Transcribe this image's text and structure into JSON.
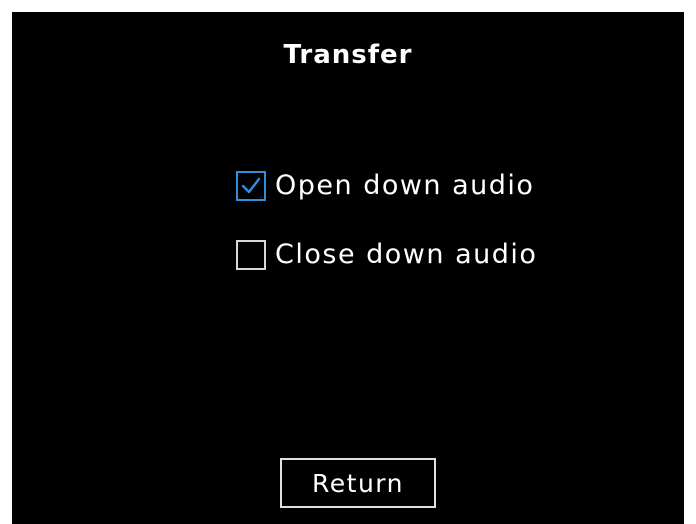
{
  "screen": {
    "title": "Transfer"
  },
  "options": [
    {
      "label": "Open down audio",
      "checked": true
    },
    {
      "label": "Close down audio",
      "checked": false
    }
  ],
  "buttons": {
    "return_label": "Return"
  },
  "colors": {
    "background": "#000000",
    "text": "#ffffff",
    "accent": "#2f8fe0",
    "border": "#d8d8d8"
  }
}
